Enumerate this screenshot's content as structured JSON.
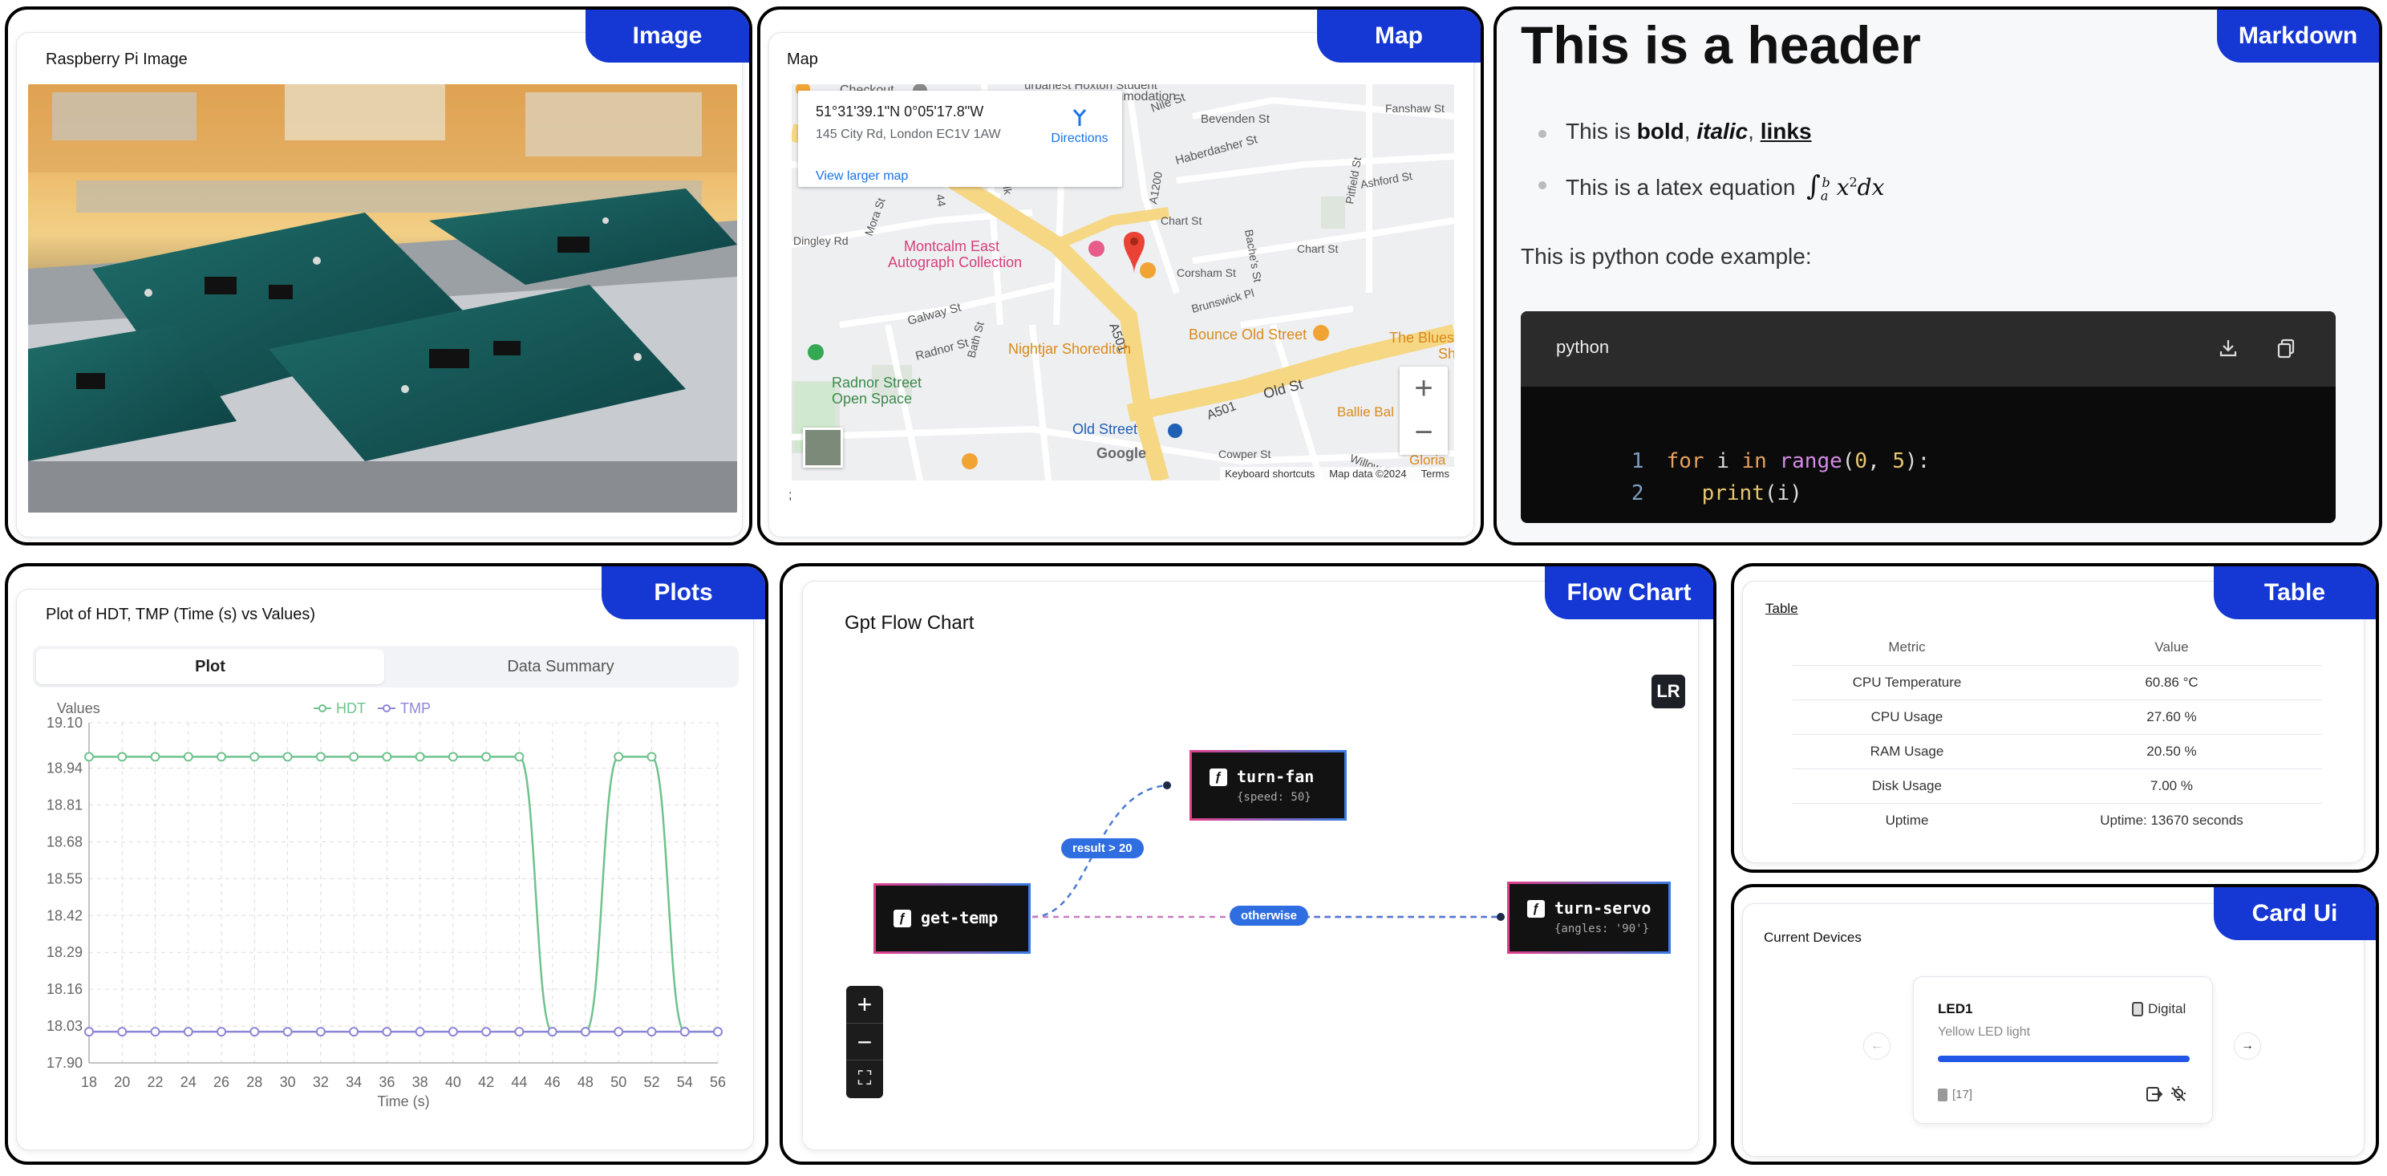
{
  "panels": {
    "image": "Image",
    "map": "Map",
    "markdown": "Markdown",
    "plots": "Plots",
    "flow": "Flow Chart",
    "table": "Table",
    "cardui": "Card Ui"
  },
  "image_card": {
    "title": "Raspberry Pi Image"
  },
  "map_card": {
    "title": "Map",
    "coords": "51°31'39.1\"N 0°05'17.8\"W",
    "address": "145 City Rd, London EC1V 1AW",
    "directions": "Directions",
    "larger": "View larger map",
    "labels": {
      "checkout": "Checkout",
      "hoxton": "urbanest Hoxton Student",
      "accommodation": "mmodation",
      "fanshaw": "Fanshaw St",
      "bevenden": "Bevenden St",
      "nile": "Nile St",
      "haberdasher": "Haberdasher St",
      "ashford": "Ashford St",
      "pitfield": "Pitfield St",
      "a1200": "A1200",
      "chart1": "Chart St",
      "chart2": "Chart St",
      "bachesst": "Bache's St",
      "dingley": "Dingley Rd",
      "mora": "Mora St",
      "num44": "44",
      "wwalk": "Walk",
      "montcalm1": "Montcalm East",
      "montcalm2": "Autograph Collection",
      "corsham": "Corsham St",
      "brunswick": "Brunswick Pl",
      "galway": "Galway St",
      "bath": "Bath St",
      "radnor": "Radnor St",
      "a501a": "A501",
      "a501b": "A501",
      "oldst": "Old St",
      "bounce": "Bounce Old Street",
      "blues1": "The Blues",
      "blues2": "Sh",
      "nightjar": "Nightjar Shoreditch",
      "radnorspace1": "Radnor Street",
      "radnorspace2": "Open Space",
      "oldstreet": "Old Street",
      "ballie": "Ballie Bal",
      "gloria": "Gloria",
      "cowper": "Cowper St",
      "willow": "Willow St",
      "google": "Google",
      "kb": "Keyboard shortcuts",
      "mapdata": "Map data ©2024",
      "terms": "Terms"
    },
    "semicolon": ";"
  },
  "markdown": {
    "header": "This is a header",
    "b1_pre": "This is ",
    "b1_bold": "bold",
    "b1_sep1": ", ",
    "b1_italic": "italic",
    "b1_sep2": ", ",
    "b1_link": "links",
    "b2": "This is a latex equation",
    "latex": {
      "int": "∫",
      "sub": "a",
      "sup": "b",
      "x": "x",
      "exp": "2",
      "dx": "dx"
    },
    "para": "This is python code example:",
    "code_lang": "python",
    "code_lines": [
      {
        "num": "1",
        "kw1": "for",
        "var": " i ",
        "kw2": "in",
        "fn": " range",
        "open": "(",
        "n0": "0",
        "comma": ", ",
        "n5": "5",
        "close": "):"
      },
      {
        "num": "2",
        "fn": "print",
        "arg": "(i)"
      }
    ]
  },
  "plots_card": {
    "title": "Plot of HDT, TMP (Time (s) vs Values)",
    "tab_plot": "Plot",
    "tab_summary": "Data Summary",
    "active_tab": "Plot"
  },
  "chart_data": {
    "type": "line",
    "xlabel": "Time (s)",
    "ylabel": "Values",
    "x": [
      18,
      20,
      22,
      24,
      26,
      28,
      30,
      32,
      34,
      36,
      38,
      40,
      42,
      44,
      46,
      48,
      50,
      52,
      54,
      56
    ],
    "xticks": [
      "18",
      "20",
      "22",
      "24",
      "26",
      "28",
      "30",
      "32",
      "34",
      "36",
      "38",
      "40",
      "42",
      "44",
      "46",
      "48",
      "50",
      "52",
      "54",
      "56"
    ],
    "yticks": [
      "19.10",
      "18.94",
      "18.81",
      "18.68",
      "18.55",
      "18.42",
      "18.29",
      "18.16",
      "18.03",
      "17.90"
    ],
    "ylim": [
      17.9,
      19.1
    ],
    "grid": true,
    "legend": "top-center",
    "series": [
      {
        "name": "HDT",
        "color": "#6fc28d",
        "values": [
          18.98,
          18.98,
          18.98,
          18.98,
          18.98,
          18.98,
          18.98,
          18.98,
          18.98,
          18.98,
          18.98,
          18.98,
          18.98,
          18.98,
          18.01,
          18.01,
          18.98,
          18.98,
          18.01,
          18.01
        ]
      },
      {
        "name": "TMP",
        "color": "#8d86d6",
        "values": [
          18.01,
          18.01,
          18.01,
          18.01,
          18.01,
          18.01,
          18.01,
          18.01,
          18.01,
          18.01,
          18.01,
          18.01,
          18.01,
          18.01,
          18.01,
          18.01,
          18.01,
          18.01,
          18.01,
          18.01
        ]
      }
    ]
  },
  "flow": {
    "title": "Gpt Flow Chart",
    "direction": "LR",
    "nodes": [
      {
        "id": "get-temp",
        "label": "get-temp",
        "sub": ""
      },
      {
        "id": "turn-fan",
        "label": "turn-fan",
        "sub": "{speed: 50}"
      },
      {
        "id": "turn-servo",
        "label": "turn-servo",
        "sub": "{angles: '90'}"
      }
    ],
    "edges": [
      {
        "label": "result > 20"
      },
      {
        "label": "otherwise"
      }
    ],
    "controls": {
      "plus": "+",
      "minus": "−",
      "fit": "⛶"
    },
    "close": "×"
  },
  "table_card": {
    "title": "Table",
    "headers": [
      "Metric",
      "Value"
    ],
    "rows": [
      [
        "CPU Temperature",
        "60.86 °C"
      ],
      [
        "CPU Usage",
        "27.60 %"
      ],
      [
        "RAM Usage",
        "20.50 %"
      ],
      [
        "Disk Usage",
        "7.00 %"
      ],
      [
        "Uptime",
        "Uptime: 13670 seconds"
      ]
    ]
  },
  "card_ui": {
    "title": "Current Devices",
    "device": {
      "name": "LED1",
      "type": "Digital",
      "desc": "Yellow LED light",
      "progress": 1.0,
      "pin": "[17]"
    },
    "prev": "←",
    "next": "→"
  }
}
